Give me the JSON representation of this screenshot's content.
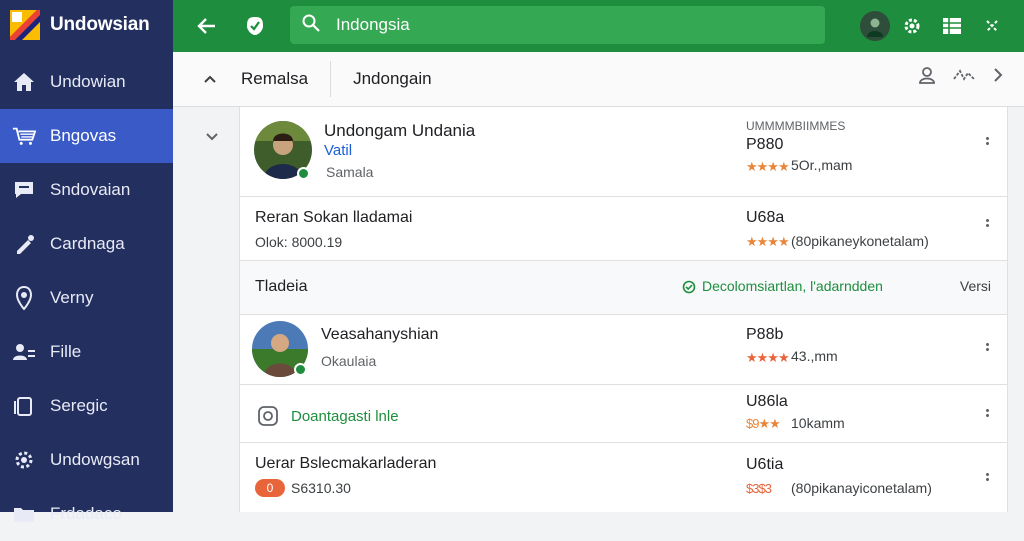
{
  "app": {
    "name": "Undowsian"
  },
  "sidebar": {
    "items": [
      {
        "label": "Undowian",
        "icon": "home-icon"
      },
      {
        "label": "Bngovas",
        "icon": "cart-icon"
      },
      {
        "label": "Sndovaian",
        "icon": "chat-icon"
      },
      {
        "label": "Cardnaga",
        "icon": "pen-icon"
      },
      {
        "label": "Verny",
        "icon": "map-pin-icon"
      },
      {
        "label": "Fille",
        "icon": "people-icon"
      },
      {
        "label": "Seregic",
        "icon": "copy-icon"
      },
      {
        "label": "Undowgsan",
        "icon": "gear-icon"
      },
      {
        "label": "Frdadaco",
        "icon": "folder-icon"
      }
    ]
  },
  "search": {
    "value": "Indongsia"
  },
  "subbar": {
    "left_title": "Remalsa",
    "right_title": "Jndongain"
  },
  "rows": [
    {
      "name": "Undongam Undania",
      "line2": "Vatil",
      "line3": "Samala",
      "price": "P880",
      "header": "UMMMMBIIMMES",
      "stars": "★★★★",
      "rating": "5Or.,mam"
    },
    {
      "name": "Reran Sokan lladamai",
      "line2": "Olok: 8000.19",
      "price": "U68a",
      "stars": "★★★★",
      "rating": "(80pikaneykonetalam)"
    },
    {
      "name": "Tladeia",
      "status": "Decolomsiartlan, l'adarndden",
      "right": "Versi"
    },
    {
      "name": "Veasahanyshian",
      "line2": "Okaulaia",
      "price": "P88b",
      "stars": "★★★★",
      "rating": "43.,mm"
    },
    {
      "name": "Doantagasti lnle",
      "price": "U86la",
      "stars": "$9★★",
      "rating": "10kamm"
    },
    {
      "name": "Uerar Bslecmakarladeran",
      "pill": "0",
      "line2": "S6310.30",
      "price": "U6tia",
      "stars": "$3$3",
      "rating": "(80pikanayiconetalam)"
    }
  ],
  "colors": {
    "sidebar": "#23305f",
    "topbar": "#1e8e3e",
    "accent": "#3a5bc7",
    "star": "#e8853a"
  }
}
